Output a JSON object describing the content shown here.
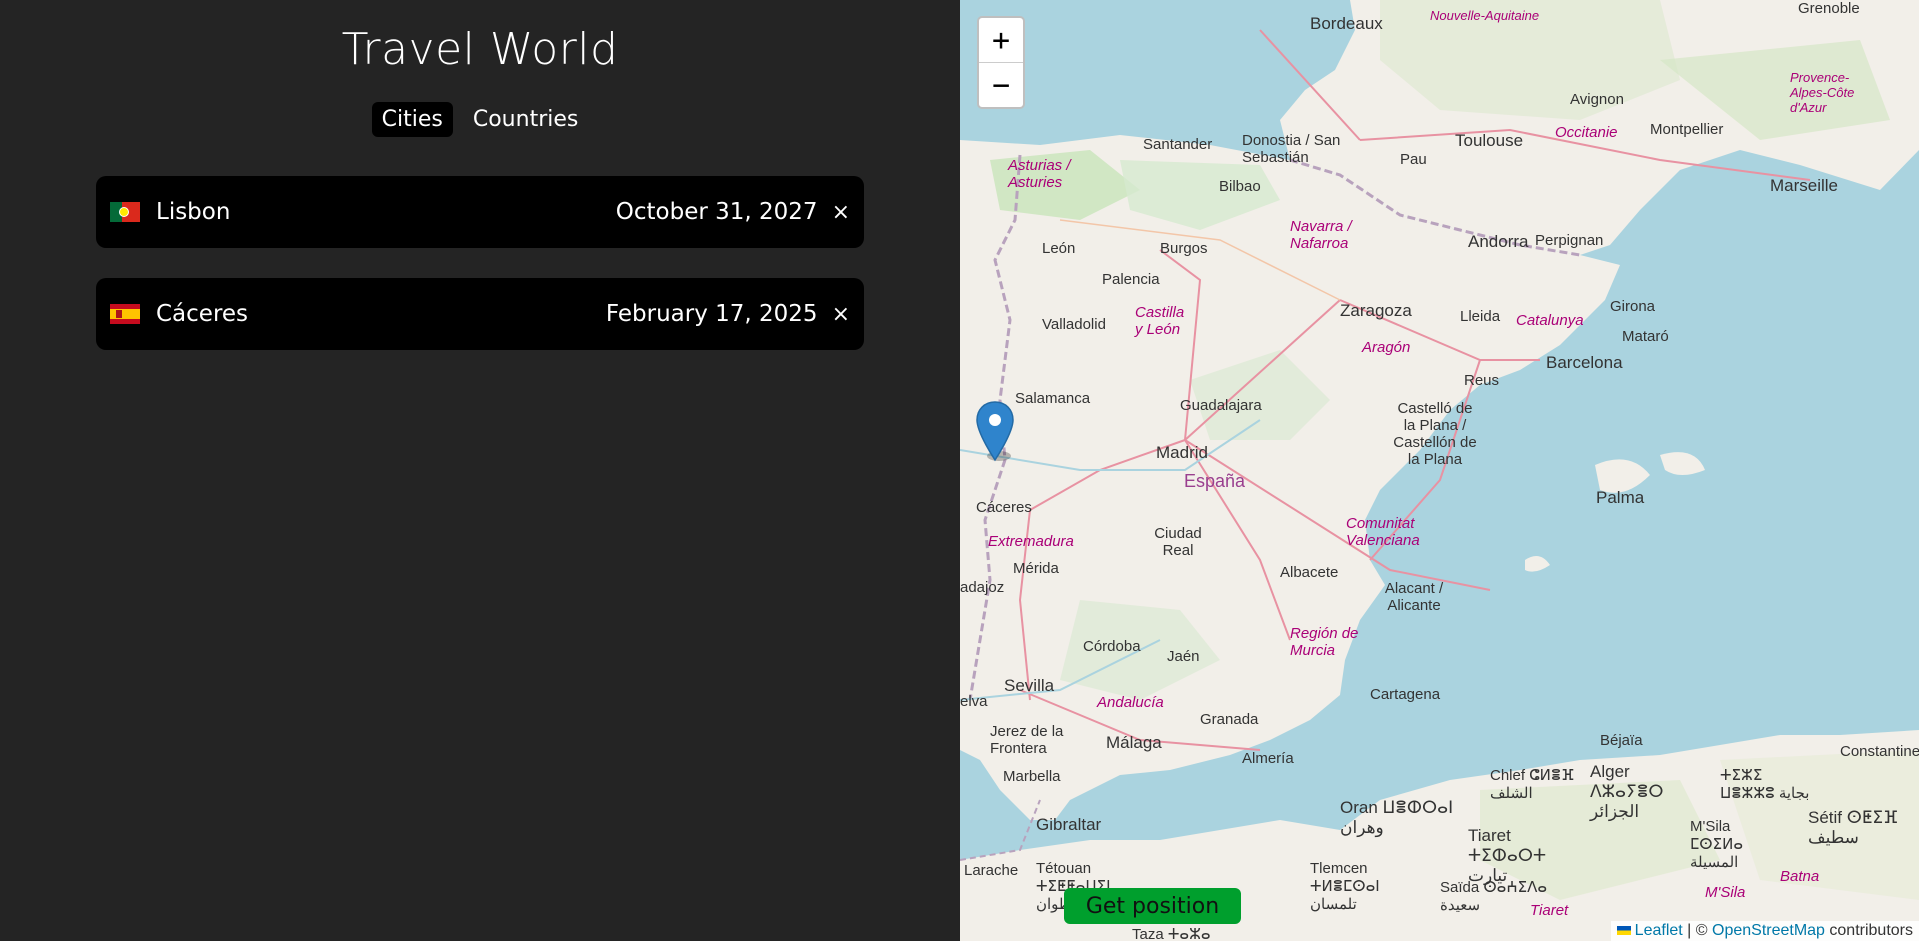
{
  "app": {
    "title": "Travel World",
    "tabs": [
      {
        "label": "Cities",
        "active": true
      },
      {
        "label": "Countries",
        "active": false
      }
    ]
  },
  "cities": [
    {
      "flag": "PT",
      "name": "Lisbon",
      "date": "October 31, 2027",
      "delete": "×"
    },
    {
      "flag": "ES",
      "name": "Cáceres",
      "date": "February 17, 2025",
      "delete": "×"
    }
  ],
  "map": {
    "zoom_in": "+",
    "zoom_out": "−",
    "get_position_label": "Get position",
    "get_position_color": "#009f2d",
    "attribution": {
      "leaflet": "Leaflet",
      "separator": " | © ",
      "osm": "OpenStreetMap",
      "suffix": " contributors"
    },
    "labels": {
      "bordeaux": "Bordeaux",
      "aquitaine": "Nouvelle-Aquitaine",
      "grenoble": "Grenoble",
      "toulouse": "Toulouse",
      "occitanie": "Occitanie",
      "montpellier": "Montpellier",
      "avignon": "Avignon",
      "provence": "Provence-Alpes-Côte d'Azur",
      "marseille": "Marseille",
      "santander": "Santander",
      "donostia": "Donostia / San Sebastián",
      "pau": "Pau",
      "asturias": "Asturias / Asturies",
      "bilbao": "Bilbao",
      "navarra": "Navarra / Nafarroa",
      "perpignan": "Perpignan",
      "andorra": "Andorra",
      "leon": "León",
      "burgos": "Burgos",
      "palencia": "Palencia",
      "castilla": "Castilla y León",
      "valladolid": "Valladolid",
      "zaragoza": "Zaragoza",
      "lleida": "Lleida",
      "catalunya": "Catalunya",
      "girona": "Girona",
      "mataro": "Mataró",
      "barcelona": "Barcelona",
      "aragon": "Aragón",
      "reus": "Reus",
      "salamanca": "Salamanca",
      "guadalajara": "Guadalajara",
      "castello": "Castelló de la Plana / Castellón de la Plana",
      "madrid": "Madrid",
      "espana": "España",
      "palma": "Palma",
      "caceres": "Cáceres",
      "extremadura": "Extremadura",
      "ciudadreal": "Ciudad Real",
      "valenciana": "Comunitat Valenciana",
      "merida": "Mérida",
      "albacete": "Albacete",
      "alacant": "Alacant / Alicante",
      "badajoz": "adajoz",
      "cordoba": "Córdoba",
      "jaen": "Jaén",
      "murcia": "Región de Murcia",
      "sevilla": "Sevilla",
      "andalucia": "Andalucía",
      "cartagena": "Cartagena",
      "huelva": "elva",
      "jerez": "Jerez de la Frontera",
      "malaga": "Málaga",
      "granada": "Granada",
      "almeria": "Almería",
      "bejaia": "Béjaïa",
      "constantine": "Constantine",
      "chlef": "Chlef ⵛⵍⴻⴼ الشلف",
      "alger": "Alger ⴷⵣⴰⵢⴻⵔ الجزائر",
      "tiziouzou": "ⵜⵉⵣⵉ ⵡⴻⵣⵣⵓ بجاية",
      "marbella": "Marbella",
      "gibraltar": "Gibraltar",
      "oran": "Oran ⵡⴻⵀⵔⴰⵏ وهران",
      "msila": "M'Sila ⵎⵙⵉⵍⴰ المسيلة",
      "setif": "Sétif ⵙⵟⵉⴼ سطيف",
      "tiaret": "Tiaret ⵜⵉⵀⴰⵔⵜ تيارت",
      "larache": "Larache",
      "tetouan": "Tétouan ⵜⵉⵟⵟⴰⵡⵉⵏ تطوان",
      "tlemcen": "Tlemcen ⵜⵍⴻⵎⵙⴰⵏ تلمسان",
      "saida": "Saïda ⵙⴰⵄⵉⴷⴰ سعيدة",
      "batna": "Batna",
      "taza": "Taza ⵜⴰⵣⴰ",
      "tiaret2": "Tiaret",
      "msila2": "M'Sila"
    }
  }
}
